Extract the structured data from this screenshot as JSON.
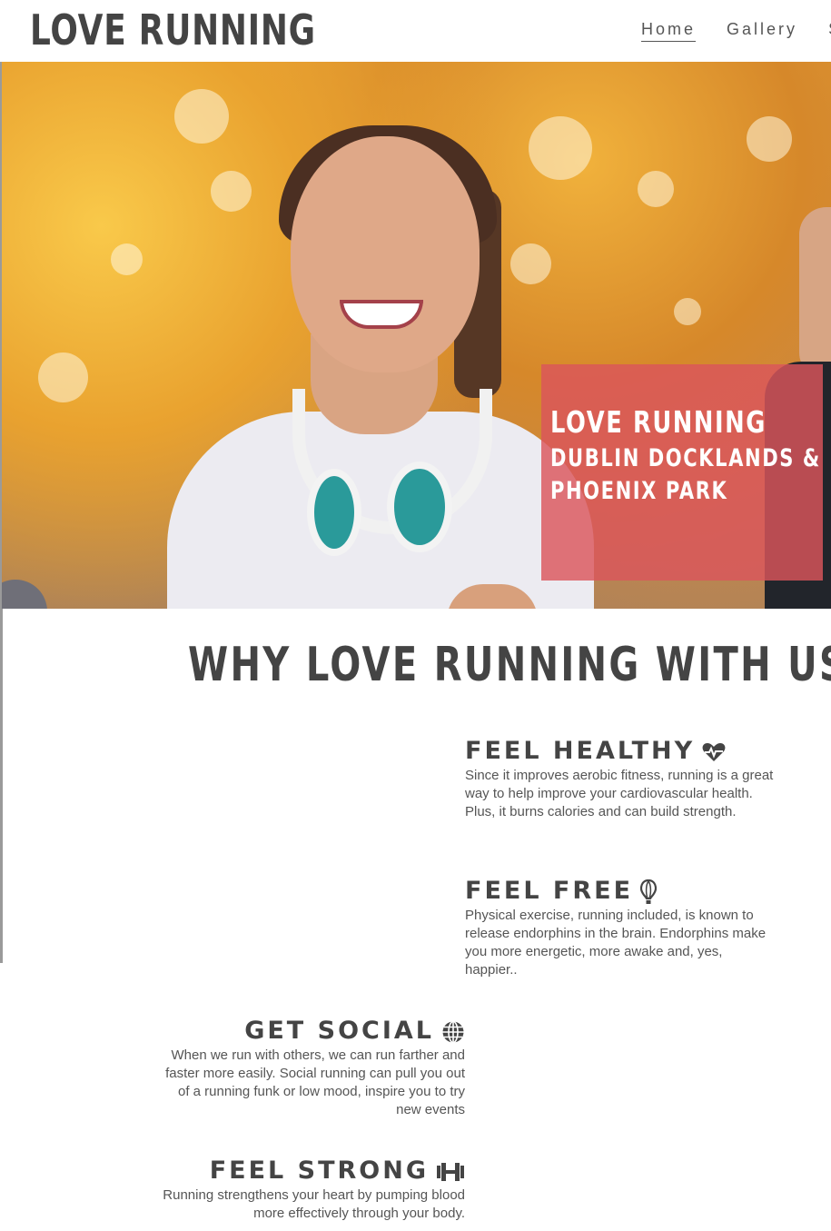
{
  "site": {
    "logo": "LOVE RUNNING"
  },
  "nav": {
    "items": [
      "Home",
      "Gallery",
      "S"
    ],
    "active": "Home"
  },
  "hero": {
    "line1": "LOVE RUNNING",
    "line2": "DUBLIN DOCKLANDS &",
    "line3": "PHOENIX PARK",
    "box_color": "#da565c"
  },
  "why": {
    "title": "WHY LOVE RUNNING WITH US?"
  },
  "features": [
    {
      "title": "FEEL HEALTHY",
      "icon": "heartbeat-icon",
      "text": "Since it improves aerobic fitness, running is a great way to help improve your cardiovascular health. Plus, it burns calories and can build strength."
    },
    {
      "title": "FEEL FREE",
      "icon": "hot-air-balloon-icon",
      "text": "Physical exercise, running included, is known to release endorphins in the brain. Endorphins make you more energetic, more awake and, yes, happier.."
    },
    {
      "title": "GET SOCIAL",
      "icon": "globe-icon",
      "text": "When we run with others, we can run farther and faster more easily. Social running can pull you out of a running funk or low mood, inspire you to try new events"
    },
    {
      "title": "FEEL STRONG",
      "icon": "dumbbell-icon",
      "text": "Running strengthens your heart by pumping blood more effectively through your body."
    }
  ]
}
